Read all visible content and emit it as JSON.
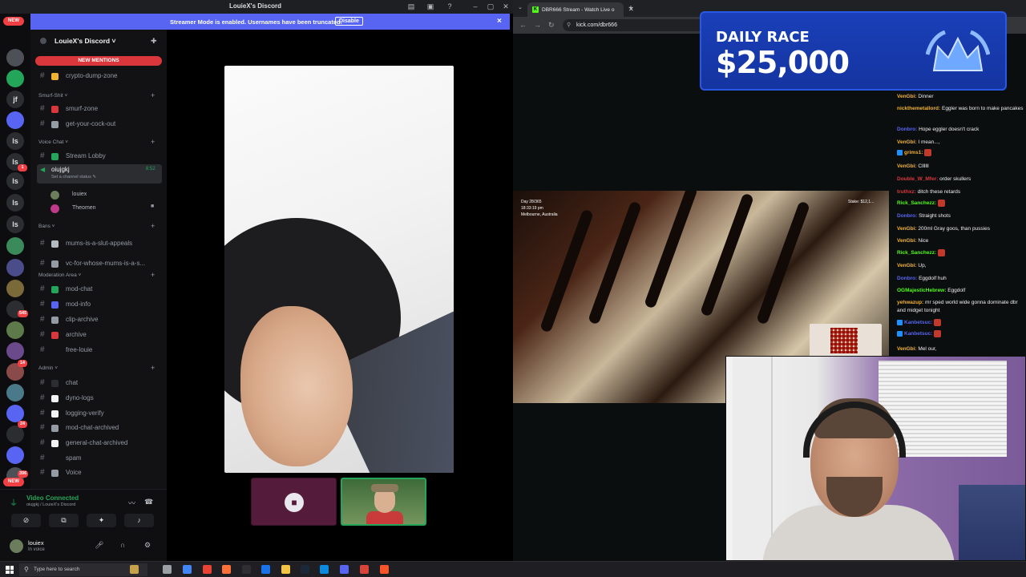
{
  "discord": {
    "window_title": "LouieX's Discord",
    "banner": {
      "text": "Streamer Mode is enabled. Usernames have been truncated.",
      "button": "Disable",
      "close": "×"
    },
    "server_name": "LouieX's Discord ˅",
    "new_mentions": "NEW MENTIONS",
    "rail": {
      "new_top": "NEW",
      "new_bottom": "NEW",
      "letters": [
        "jf",
        "ls",
        "ls",
        "ls",
        "ls",
        "ls"
      ],
      "counts": [
        "1",
        "545",
        "14",
        "24",
        "396"
      ]
    },
    "channels": [
      {
        "type": "channel",
        "label": "crypto-dump-zone",
        "emoji_color": "#f0b232"
      },
      {
        "type": "category",
        "label": "Smurf-Shit ˅"
      },
      {
        "type": "channel",
        "label": "smurf-zone",
        "emoji_color": "#da373c"
      },
      {
        "type": "channel",
        "label": "get-your-cock-out",
        "emoji_color": "#949ba4"
      },
      {
        "type": "category",
        "label": "Voice Chat ˅"
      },
      {
        "type": "channel",
        "label": "Stream Lobby",
        "emoji_color": "#23a55a"
      },
      {
        "type": "category",
        "label": "Bans ˅"
      },
      {
        "type": "channel",
        "label": "mums-is-a-slut-appeals",
        "emoji_color": "#b5bac1"
      },
      {
        "type": "channel",
        "label": "vc-for-whose-mums-is-a-s...",
        "emoji_color": "#949ba4"
      },
      {
        "type": "category",
        "label": "Moderation Area ˅"
      },
      {
        "type": "channel",
        "label": "mod-chat",
        "emoji_color": "#23a55a"
      },
      {
        "type": "channel",
        "label": "mod-info",
        "emoji_color": "#5865f2"
      },
      {
        "type": "channel",
        "label": "clip-archive",
        "emoji_color": "#949ba4"
      },
      {
        "type": "channel",
        "label": "archive",
        "emoji_color": "#da373c"
      },
      {
        "type": "channel",
        "label": "free-louie",
        "emoji_color": ""
      },
      {
        "type": "category",
        "label": "Admin ˅"
      },
      {
        "type": "channel",
        "label": "chat",
        "emoji_color": "#2b2d31"
      },
      {
        "type": "channel",
        "label": "dyno-logs",
        "emoji_color": "#f2f3f5"
      },
      {
        "type": "channel",
        "label": "logging-verify",
        "emoji_color": "#f2f3f5"
      },
      {
        "type": "channel",
        "label": "mod-chat-archived",
        "emoji_color": "#949ba4"
      },
      {
        "type": "channel",
        "label": "general-chat-archived",
        "emoji_color": "#f2f3f5"
      },
      {
        "type": "channel",
        "label": "spam",
        "emoji_color": ""
      },
      {
        "type": "channel",
        "label": "Voice",
        "emoji_color": "#949ba4"
      }
    ],
    "active_voice_channel": {
      "label": "oiujgkj",
      "status": "Set a channel status ✎",
      "time": "8:52"
    },
    "voice_users": [
      {
        "name": "louiex",
        "color": "#6b7d5c"
      },
      {
        "name": "Theomen",
        "color": "#c03a8a"
      }
    ],
    "voice_panel": {
      "status": "Video Connected",
      "sub": "oiujgkj / LouieX's Discord",
      "user": "louiex",
      "user_status": "In voice"
    }
  },
  "browser": {
    "tab_title": "DBR666 Stream - Watch Live o",
    "url": "kick.com/dbr666",
    "promo": {
      "line1": "DAILY RACE",
      "line2": "$25,000"
    },
    "stream_overlay": {
      "day": "Day 28/365",
      "time": "18:33:19 pm",
      "location": "Melbourne, Australia",
      "counter": "Stake: $12,1..."
    },
    "chat": [
      {
        "user": "VenGbi",
        "color": "#f0b232",
        "text": "Dinner",
        "emote": false
      },
      {
        "user": "nickthemetallord",
        "color": "#f0b232",
        "text": "Eggler was born to make pancakes",
        "emote": false
      },
      {
        "user": "Donbro",
        "color": "#5865f2",
        "text": "Hope eggler doesn't crack",
        "emote": false
      },
      {
        "user": "VenGbi",
        "color": "#f0b232",
        "text": "I mean...,",
        "emote": false
      },
      {
        "user": "grims1",
        "color": "#f0b232",
        "text": "",
        "emote": true
      },
      {
        "user": "VenGbi",
        "color": "#f0b232",
        "text": "Cllllll",
        "emote": false
      },
      {
        "user": "Double_W_Mfer",
        "color": "#da373c",
        "text": "order skullers",
        "emote": false
      },
      {
        "user": "truthxz",
        "color": "#da373c",
        "text": "ditch these retards",
        "emote": false
      },
      {
        "user": "Rick_Sanchezz",
        "color": "#53fc18",
        "text": "",
        "emote": true
      },
      {
        "user": "Donbro",
        "color": "#5865f2",
        "text": "Straight shots",
        "emote": false
      },
      {
        "user": "VenGbi",
        "color": "#f0b232",
        "text": "200ml Gray goos, than pussies",
        "emote": false
      },
      {
        "user": "VenGbi",
        "color": "#f0b232",
        "text": "Nice",
        "emote": false
      },
      {
        "user": "Rick_Sanchezz",
        "color": "#53fc18",
        "text": "",
        "emote": true
      },
      {
        "user": "VenGbi",
        "color": "#f0b232",
        "text": "Up,",
        "emote": false
      },
      {
        "user": "Donbro",
        "color": "#5865f2",
        "text": "Eggdolf huh",
        "emote": false
      },
      {
        "user": "OGMajesticHebrew",
        "color": "#53fc18",
        "text": "Eggdolf",
        "emote": false
      },
      {
        "user": "yehwazup",
        "color": "#f0b232",
        "text": "mr sped world wide gonna dominate dbr and midget tonight",
        "emote": false
      },
      {
        "user": "Kanbetsuc",
        "color": "#5865f2",
        "text": "",
        "emote": true
      },
      {
        "user": "Kanbetsuc",
        "color": "#5865f2",
        "text": "",
        "emote": true
      },
      {
        "user": "VenGbi",
        "color": "#f0b232",
        "text": "Mel our,",
        "emote": false
      }
    ]
  },
  "taskbar": {
    "search_placeholder": "Type here to search"
  }
}
